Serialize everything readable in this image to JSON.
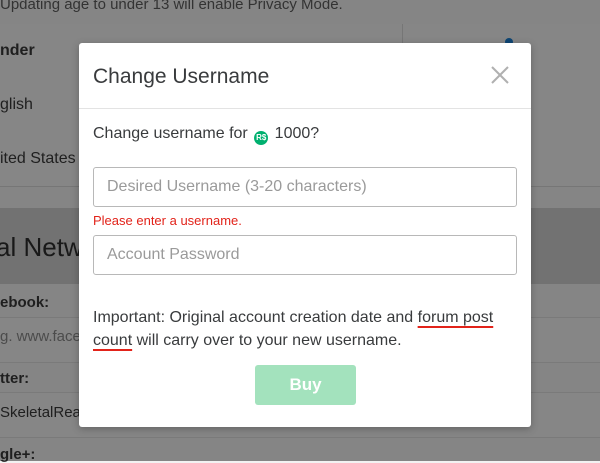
{
  "background": {
    "top_note": "Updating age to under 13 will enable Privacy Mode.",
    "rows": [
      "nder",
      "glish",
      "ited States"
    ],
    "section_title": "al Netw",
    "fields": [
      {
        "label": "ebook:",
        "value": "g. www.face"
      },
      {
        "label": "tter:",
        "value": "SkeletalRea"
      },
      {
        "label": "gle+:",
        "value": ""
      }
    ]
  },
  "modal": {
    "title": "Change Username",
    "description_prefix": "Change username for",
    "currency_icon": "robux-icon",
    "price": "1000?",
    "username_placeholder": "Desired Username (3-20 characters)",
    "error": "Please enter a username.",
    "password_placeholder": "Account Password",
    "note_prefix": "Important: Original account creation date and ",
    "note_highlight": "forum post count",
    "note_suffix": " will carry over to your new username.",
    "buy_label": "Buy"
  },
  "colors": {
    "accent_green": "#00b06f",
    "buy_disabled": "#a3e2bd",
    "error_red": "#e2231a"
  }
}
